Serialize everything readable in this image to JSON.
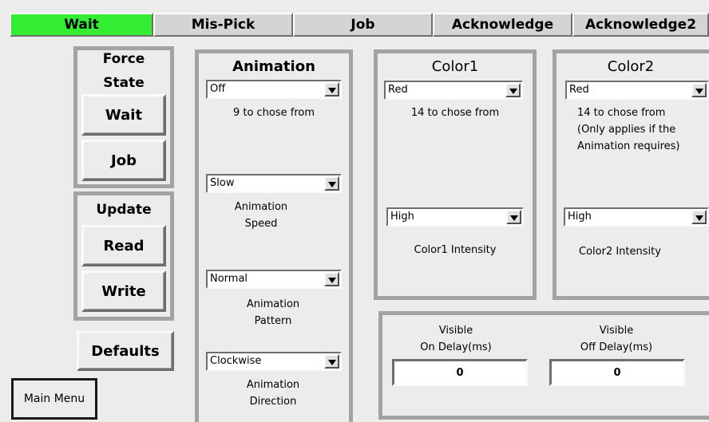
{
  "tabs": [
    {
      "label": "Wait",
      "active": true
    },
    {
      "label": "Mis-Pick"
    },
    {
      "label": "Job"
    },
    {
      "label": "Acknowledge"
    },
    {
      "label": "Acknowledge2"
    }
  ],
  "force_state": {
    "title_line1": "Force",
    "title_line2": "State",
    "wait_label": "Wait",
    "job_label": "Job"
  },
  "update": {
    "title": "Update",
    "read_label": "Read",
    "write_label": "Write"
  },
  "defaults_label": "Defaults",
  "main_menu_label": "Main Menu",
  "animation": {
    "title": "Animation",
    "type_value": "Off",
    "type_hint": "9 to chose from",
    "speed_value": "Slow",
    "speed_label_1": "Animation",
    "speed_label_2": "Speed",
    "pattern_value": "Normal",
    "pattern_label_1": "Animation",
    "pattern_label_2": "Pattern",
    "direction_value": "Clockwise",
    "direction_label_1": "Animation",
    "direction_label_2": "Direction"
  },
  "color1": {
    "title": "Color1",
    "color_value": "Red",
    "hint": "14 to chose from",
    "intensity_value": "High",
    "intensity_label": "Color1 Intensity"
  },
  "color2": {
    "title": "Color2",
    "color_value": "Red",
    "hint_1": "14 to chose from",
    "hint_2": "(Only applies if the",
    "hint_3": "Animation requires)",
    "intensity_value": "High",
    "intensity_label": "Color2 Intensity"
  },
  "visible": {
    "on_label_1": "Visible",
    "on_label_2": "On Delay(ms)",
    "on_value": "0",
    "off_label_1": "Visible",
    "off_label_2": "Off Delay(ms)",
    "off_value": "0"
  },
  "colors": {
    "active_tab": "#33ee33",
    "frame": "#a3a3a3",
    "background": "#ececec"
  }
}
